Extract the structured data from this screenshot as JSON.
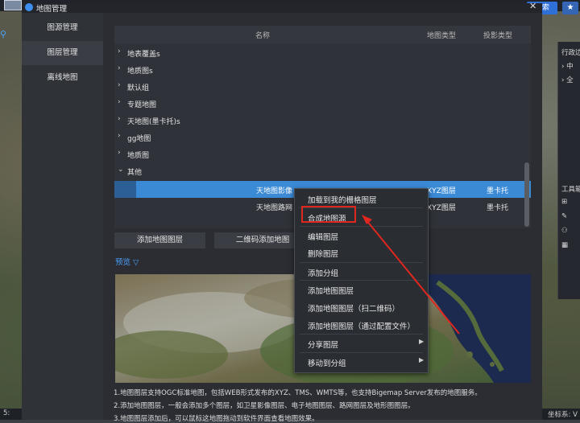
{
  "dialog": {
    "title": "地图管理",
    "close_icon": "close-icon"
  },
  "sidebar": {
    "items": [
      {
        "label": "图源管理"
      },
      {
        "label": "图层管理"
      },
      {
        "label": "离线地图"
      }
    ]
  },
  "background": {
    "search_label": "搜索",
    "right_panel": {
      "region_label": "行政边",
      "items": [
        "中",
        "全"
      ],
      "toolbox_label": "工具箱"
    },
    "status_left": "5:",
    "status_right": "坐标系: V"
  },
  "table": {
    "headers": [
      "名称",
      "地图类型",
      "投影类型"
    ],
    "groups": [
      {
        "label": "地表覆盖s",
        "expanded": false
      },
      {
        "label": "地质图s",
        "expanded": false
      },
      {
        "label": "默认组",
        "expanded": false
      },
      {
        "label": "专题地图",
        "expanded": false
      },
      {
        "label": "天地图(墨卡托)s",
        "expanded": false
      },
      {
        "label": "gg地图",
        "expanded": false
      },
      {
        "label": "地质图",
        "expanded": false
      },
      {
        "label": "其他",
        "expanded": true
      }
    ],
    "rows": [
      {
        "name": "天地图影像",
        "type": "XYZ图层",
        "projection": "墨卡托",
        "selected": true
      },
      {
        "name": "天地图路网",
        "type": "XYZ图层",
        "projection": "墨卡托",
        "selected": false
      }
    ]
  },
  "buttons": {
    "add_layer": "添加地图图层",
    "qr_add": "二维码添加地图"
  },
  "preview": {
    "label": "预览 ▽"
  },
  "notes": [
    "1.地图图层支持OGC标准地图，包括WEB形式发布的XYZ、TMS、WMTS等，也支持Bigemap Server发布的地图服务。",
    "2.添加地图图层，一般会添加多个图层，如卫星影像图层、电子地图图层、路网图层及地形图图层。",
    "3.地图图层添加后，可以鼠标这地图拖动到软件界面查看地图效果。"
  ],
  "context_menu": {
    "items": [
      {
        "label": "加载到我的栅格图层",
        "submenu": false
      },
      {
        "label": "合成地图源",
        "submenu": false,
        "highlighted": true
      },
      {
        "label": "编辑图层",
        "submenu": false
      },
      {
        "label": "删除图层",
        "submenu": false
      },
      {
        "label": "添加分组",
        "submenu": false
      },
      {
        "label": "添加地图图层",
        "submenu": false
      },
      {
        "label": "添加地图图层（扫二维码）",
        "submenu": false
      },
      {
        "label": "添加地图图层（通过配置文件）",
        "submenu": false
      },
      {
        "label": "分享图层",
        "submenu": true
      },
      {
        "label": "移动到分组",
        "submenu": true
      }
    ]
  },
  "annotation": {
    "highlight_color": "#e0271f",
    "arrow_color": "#e0271f"
  }
}
